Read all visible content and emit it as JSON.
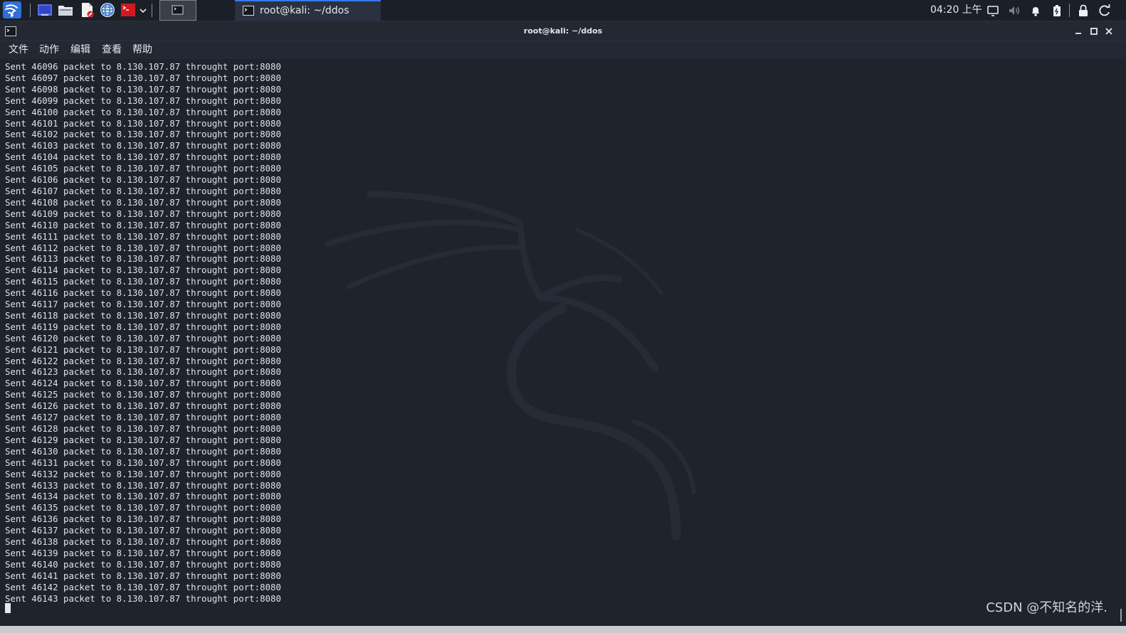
{
  "taskbar": {
    "launchers": [
      {
        "icon": "kali-menu-icon"
      },
      {
        "icon": "desktop-icon"
      },
      {
        "icon": "file-manager-icon"
      },
      {
        "icon": "text-editor-icon"
      },
      {
        "icon": "browser-icon"
      },
      {
        "icon": "terminal-launcher-icon"
      }
    ],
    "active_task": {
      "label": "root@kali: ~/ddos"
    },
    "clock": "04:20 上午",
    "tray": [
      "display-icon",
      "volume-icon",
      "notification-bell-icon",
      "battery-icon",
      "lock-icon",
      "power-icon"
    ],
    "accent": "#367bf0"
  },
  "window": {
    "title": "root@kali: ~/ddos",
    "menu": [
      "文件",
      "动作",
      "编辑",
      "查看",
      "帮助"
    ]
  },
  "terminal": {
    "first_packet": 46096,
    "last_packet": 46143,
    "line_prefix": "Sent",
    "line_middle": "packet to",
    "target_ip": "8.130.107.87",
    "line_suffix": "throught port:8080",
    "text_color": "#dfe2e6",
    "background": "#1e232c"
  },
  "watermark": "CSDN @不知名的洋."
}
